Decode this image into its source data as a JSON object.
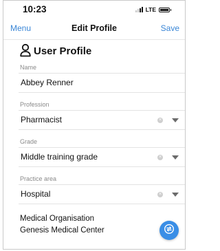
{
  "status_bar": {
    "time": "10:23",
    "network": "LTE"
  },
  "nav": {
    "left": "Menu",
    "title": "Edit Profile",
    "right": "Save"
  },
  "header": {
    "title": "User Profile",
    "icon": "user-icon"
  },
  "fields": {
    "name": {
      "label": "Name",
      "value": "Abbey Renner"
    },
    "profession": {
      "label": "Profession",
      "value": "Pharmacist"
    },
    "grade": {
      "label": "Grade",
      "value": "Middle training grade"
    },
    "practice_area": {
      "label": "Practice area",
      "value": "Hospital"
    }
  },
  "organisation": {
    "label": "Medical Organisation",
    "value": "Genesis Medical Center"
  },
  "colors": {
    "accent": "#3a86d6",
    "fab": "#3a8ee6"
  },
  "fab": {
    "icon": "swap-icon"
  }
}
